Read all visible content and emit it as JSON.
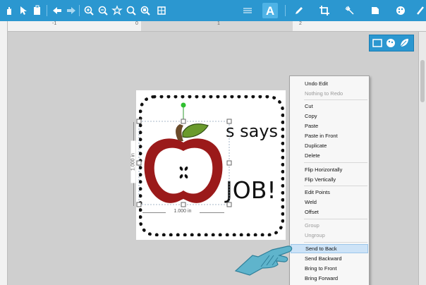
{
  "toolbar": {
    "icons": [
      "grab-icon",
      "pointer-icon",
      "clipboard-icon",
      "undo-icon",
      "redo-icon",
      "zoom-in-icon",
      "zoom-out-icon",
      "zoom-fit-icon",
      "zoom-selection-icon",
      "zoom-page-icon",
      "grid-icon",
      "lines-icon",
      "text-icon",
      "pencil-icon",
      "crop-icon",
      "knife-icon",
      "replicate-icon",
      "palette-icon",
      "brush-icon"
    ],
    "text_tool_label": "A"
  },
  "ruler": {
    "marks": [
      "-1",
      "0",
      "1",
      "2"
    ]
  },
  "design": {
    "says_text": "s says",
    "job_text": "JOB!",
    "height_dim": "1.000 in",
    "width_dim": "1.000 in"
  },
  "context_menu": {
    "items": [
      {
        "label": "Undo Edit",
        "enabled": true
      },
      {
        "label": "Nothing to Redo",
        "enabled": false
      },
      {
        "label": "Cut",
        "enabled": true
      },
      {
        "label": "Copy",
        "enabled": true
      },
      {
        "label": "Paste",
        "enabled": true
      },
      {
        "label": "Paste in Front",
        "enabled": true
      },
      {
        "label": "Duplicate",
        "enabled": true
      },
      {
        "label": "Delete",
        "enabled": true
      },
      {
        "label": "Flip Horizontally",
        "enabled": true
      },
      {
        "label": "Flip Vertically",
        "enabled": true
      },
      {
        "label": "Edit Points",
        "enabled": true
      },
      {
        "label": "Weld",
        "enabled": true
      },
      {
        "label": "Offset",
        "enabled": true
      },
      {
        "label": "Group",
        "enabled": false
      },
      {
        "label": "Ungroup",
        "enabled": false
      },
      {
        "label": "Send to Back",
        "enabled": true,
        "highlighted": true
      },
      {
        "label": "Send Backward",
        "enabled": true
      },
      {
        "label": "Bring to Front",
        "enabled": true
      },
      {
        "label": "Bring Forward",
        "enabled": true
      }
    ]
  },
  "colors": {
    "toolbar": "#2b97d0",
    "apple_red": "#9b1a1a",
    "leaf_green": "#6a9a2c",
    "stem_brown": "#6b4a2a",
    "arrow_teal": "#5fb4cc",
    "highlight": "#cde3f7"
  }
}
